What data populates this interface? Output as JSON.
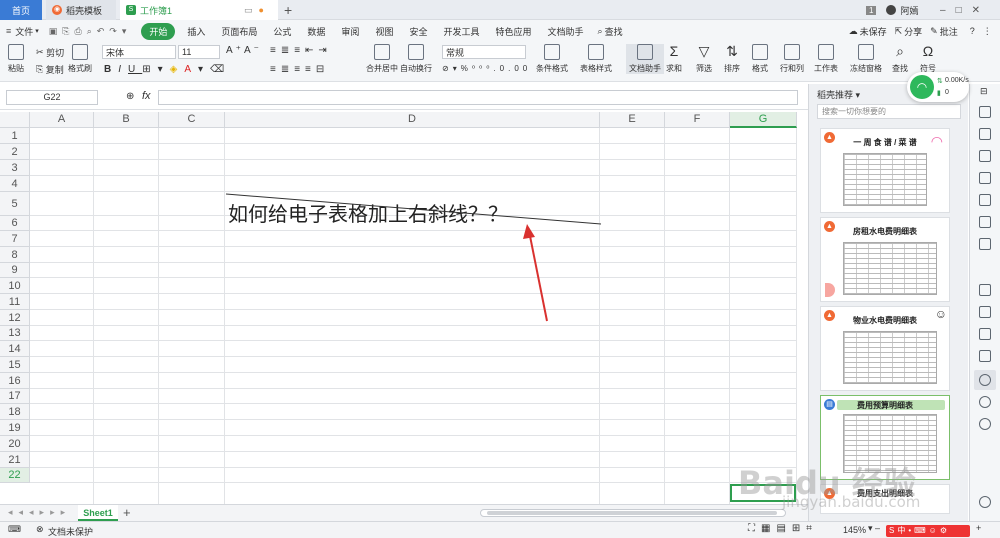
{
  "tabs": {
    "home": "首页",
    "template": "稻壳模板",
    "doc": "工作簿1"
  },
  "user": {
    "name": "阿嫣",
    "badge": "1"
  },
  "menu": {
    "file": "文件",
    "items": [
      "开始",
      "插入",
      "页面布局",
      "公式",
      "数据",
      "审阅",
      "视图",
      "安全",
      "开发工具",
      "特色应用",
      "文档助手"
    ],
    "search": "查找",
    "unsaved": "未保存",
    "share": "分享",
    "comment": "批注"
  },
  "ribbon": {
    "paste": "粘贴",
    "cut": "剪切",
    "copy": "复制",
    "format_painter": "格式刷",
    "font_name": "宋体",
    "font_size": "11",
    "merge_center": "合并居中",
    "wrap": "自动换行",
    "number_format": "常规",
    "cond_format": "条件格式",
    "table_style": "表格样式",
    "doc_helper": "文档助手",
    "sum": "求和",
    "filter": "筛选",
    "sort": "排序",
    "format": "格式",
    "rows_cols": "行和列",
    "worksheet": "工作表",
    "freeze": "冻结窗格",
    "find": "查找",
    "symbol": "符号"
  },
  "formula_bar": {
    "cell_ref": "G22",
    "fx": "fx"
  },
  "grid": {
    "columns": [
      "A",
      "B",
      "C",
      "D",
      "E",
      "F",
      "G"
    ],
    "rows": [
      "1",
      "2",
      "3",
      "4",
      "5",
      "6",
      "7",
      "8",
      "9",
      "10",
      "11",
      "12",
      "13",
      "14",
      "15",
      "16",
      "17",
      "18",
      "19",
      "20",
      "21",
      "22"
    ],
    "cell_text": "如何给电子表格加上右斜线？？"
  },
  "sheets": {
    "active": "Sheet1",
    "add": "+"
  },
  "status": {
    "protect": "文档未保护",
    "zoom": "145%"
  },
  "right_panel": {
    "title": "稻壳推荐",
    "search_placeholder": "搜索一切你想要的",
    "templates": [
      {
        "title": "一 周 食 谱 / 菜 谱"
      },
      {
        "title": "房租水电费明细表"
      },
      {
        "title": "物业水电费明细表"
      },
      {
        "title": "费用预算明细表"
      },
      {
        "title": "费用支出明细表"
      }
    ]
  },
  "network": {
    "speed": "0.00K/s",
    "count": "0"
  },
  "watermark": "Baidu 经验",
  "watermark_url": "jingyan.baidu.com",
  "colors": {
    "green": "#2e9e4f",
    "blue": "#3a7bd5",
    "arrow": "#d9312f"
  }
}
